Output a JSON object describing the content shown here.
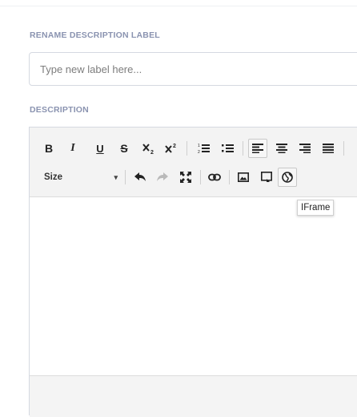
{
  "rename": {
    "label": "RENAME DESCRIPTION LABEL",
    "placeholder": "Type new label here..."
  },
  "description": {
    "label": "DESCRIPTION"
  },
  "toolbar": {
    "bold": "B",
    "italic": "I",
    "underline": "U",
    "strike": "S",
    "size_label": "Size",
    "size_caret": "▾",
    "icons": [
      "bold-icon",
      "italic-icon",
      "underline-icon",
      "strikethrough-icon",
      "subscript-icon",
      "superscript-icon",
      "numbered-list-icon",
      "bulleted-list-icon",
      "align-left-icon",
      "align-center-icon",
      "align-right-icon",
      "justify-icon",
      "undo-icon",
      "redo-icon",
      "maximize-icon",
      "link-icon",
      "image-icon",
      "media-icon",
      "iframe-icon"
    ]
  },
  "tooltip": {
    "text": "IFrame"
  },
  "colors": {
    "label": "#8a93b0",
    "toolbar_bg": "#f3f3f3",
    "border": "#d5d9e1"
  }
}
